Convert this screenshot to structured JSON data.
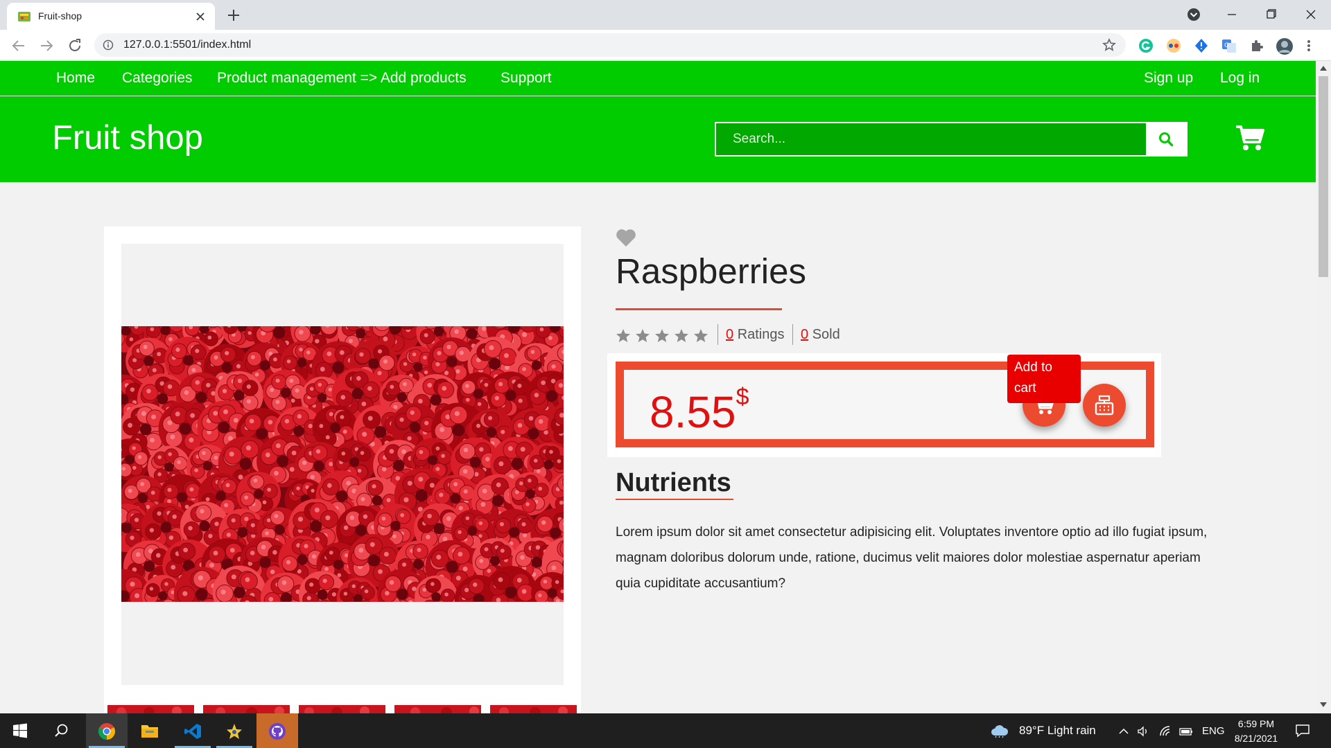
{
  "browser": {
    "tab_title": "Fruit-shop",
    "url": "127.0.0.1:5501/index.html"
  },
  "nav": {
    "links": [
      "Home",
      "Categories",
      "Product management => Add products",
      "Support"
    ],
    "signup": "Sign up",
    "login": "Log in"
  },
  "header": {
    "brand": "Fruit shop",
    "search_placeholder": "Search..."
  },
  "product": {
    "name": "Raspberries",
    "rating_stars": 0,
    "ratings_count": "0",
    "ratings_label": "Ratings",
    "sold_count": "0",
    "sold_label": "Sold",
    "price": "8.55",
    "currency": "$",
    "add_to_cart_tooltip": "Add to cart"
  },
  "nutrients": {
    "title": "Nutrients",
    "text": "Lorem ipsum dolor sit amet consectetur adipisicing elit. Voluptates inventore optio ad illo fugiat ipsum, magnam doloribus dolorum unde, ratione, ducimus velit maiores dolor molestiae aspernatur aperiam quia cupiditate accusantium?"
  },
  "taskbar": {
    "weather": "89°F  Light rain",
    "language": "ENG",
    "time": "6:59 PM",
    "date": "8/21/2021"
  },
  "colors": {
    "brand_green": "#00cc00",
    "accent_red": "#ec4b2f",
    "price_red": "#e01010"
  }
}
